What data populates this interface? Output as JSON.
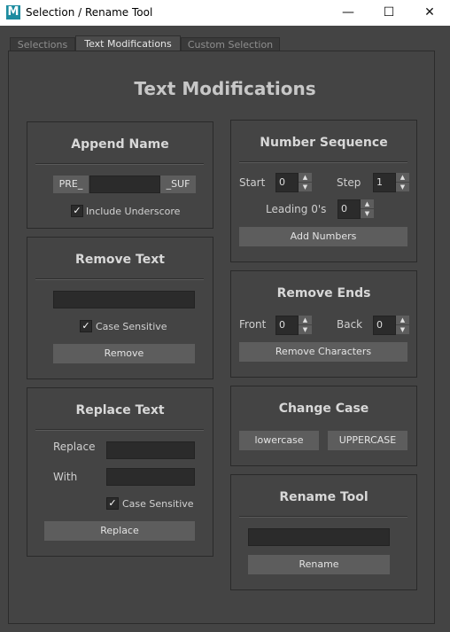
{
  "window": {
    "title": "Selection / Rename Tool",
    "app_icon": "M"
  },
  "tabs": [
    "Selections",
    "Text Modifications",
    "Custom Selection"
  ],
  "page_title": "Text Modifications",
  "append": {
    "title": "Append Name",
    "prefix": "PRE_",
    "suffix": "_SUF",
    "name_value": "",
    "underscore_label": "Include Underscore",
    "underscore_checked": true
  },
  "remove_text": {
    "title": "Remove Text",
    "value": "",
    "case_label": "Case Sensitive",
    "button": "Remove"
  },
  "replace_text": {
    "title": "Replace Text",
    "replace_label": "Replace",
    "with_label": "With",
    "replace_value": "",
    "with_value": "",
    "case_label": "Case Sensitive",
    "button": "Replace"
  },
  "number_seq": {
    "title": "Number Sequence",
    "start_label": "Start",
    "start_value": "0",
    "step_label": "Step",
    "step_value": "1",
    "leading_label": "Leading 0's",
    "leading_value": "0",
    "button": "Add Numbers"
  },
  "remove_ends": {
    "title": "Remove Ends",
    "front_label": "Front",
    "front_value": "0",
    "back_label": "Back",
    "back_value": "0",
    "button": "Remove Characters"
  },
  "change_case": {
    "title": "Change Case",
    "lower_button": "lowercase",
    "upper_button": "UPPERCASE"
  },
  "rename": {
    "title": "Rename Tool",
    "value": "",
    "button": "Rename"
  },
  "colors": {
    "background": "#444444",
    "field": "#2b2b2b",
    "button": "#5d5d5d",
    "title_icon": "#1d8ca0"
  }
}
